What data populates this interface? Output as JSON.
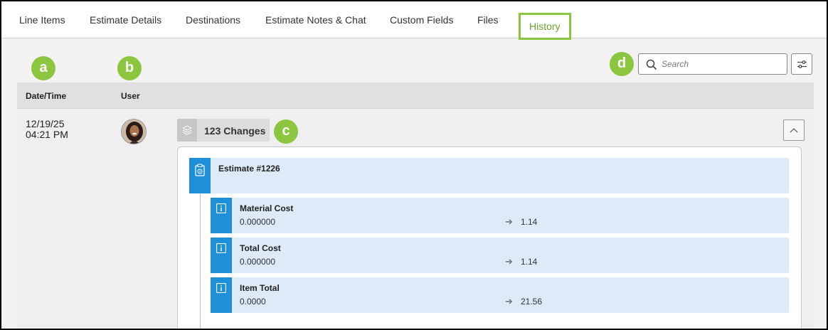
{
  "tabs": [
    {
      "label": "Line Items"
    },
    {
      "label": "Estimate Details"
    },
    {
      "label": "Destinations"
    },
    {
      "label": "Estimate Notes & Chat"
    },
    {
      "label": "Custom Fields"
    },
    {
      "label": "Files"
    },
    {
      "label": "History",
      "active": true
    }
  ],
  "callouts": {
    "a": "a",
    "b": "b",
    "c": "c",
    "d": "d"
  },
  "search": {
    "placeholder": "Search",
    "value": ""
  },
  "table": {
    "headers": {
      "datetime": "Date/Time",
      "user": "User"
    }
  },
  "row": {
    "date": "12/19/25",
    "time": "04:21 PM",
    "changes_label": "123 Changes",
    "estimate": {
      "title": "Estimate #1226"
    },
    "changes": [
      {
        "field": "Material Cost",
        "old": "0.000000",
        "new": "1.14"
      },
      {
        "field": "Total Cost",
        "old": "0.000000",
        "new": "1.14"
      },
      {
        "field": "Item Total",
        "old": "0.0000",
        "new": "21.56"
      }
    ]
  },
  "colors": {
    "accent": "#8cc63f",
    "entry_bar": "#1f8fd8",
    "entry_bg": "#dcebf7"
  },
  "icons": [
    "search-icon",
    "filter-sliders-icon",
    "layers-icon",
    "chevron-up-icon",
    "clipboard-icon",
    "info-icon",
    "arrow-right-icon",
    "user-avatar"
  ]
}
